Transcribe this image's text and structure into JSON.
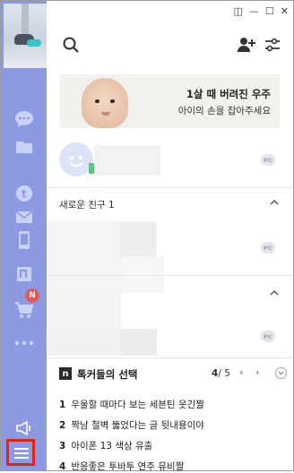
{
  "window": {
    "controls": [
      "◫",
      "—",
      "☐",
      "✕"
    ]
  },
  "sidebar": {
    "items": [
      {
        "icon": "chat-bubble-icon"
      },
      {
        "icon": "folder-icon"
      },
      {
        "icon": "t-coin-icon"
      },
      {
        "icon": "mail-icon"
      },
      {
        "icon": "mobile-icon"
      },
      {
        "icon": "n-store-icon"
      },
      {
        "icon": "shopping-cart-icon",
        "badge": "N"
      },
      {
        "icon": "more-dots-icon"
      }
    ],
    "bottom": [
      {
        "icon": "speaker-icon"
      },
      {
        "icon": "hamburger-menu-icon"
      }
    ]
  },
  "header": {
    "search_icon": "search-icon",
    "add_friend_icon": "add-friend-icon",
    "settings_icon": "settings-sliders-icon"
  },
  "banner": {
    "title": "1살 때 버려진 우주",
    "subtitle": "아이의 손을 잡아주세요"
  },
  "profile": {
    "tag": "PC"
  },
  "new_friends": {
    "title": "새로운 친구 1",
    "tag": "PC"
  },
  "section2": {
    "tag": "PC"
  },
  "picks": {
    "logo": "n",
    "title": "톡커들의 선택",
    "page_current": "4",
    "page_total": "/ 5",
    "prev": "‹",
    "next": "›",
    "items": [
      {
        "num": "1",
        "text": "우울할 때마다 보는 세븐틴 웃긴짤"
      },
      {
        "num": "2",
        "text": "짝남 철벽 뚫었다는 글 뒷내용이야"
      },
      {
        "num": "3",
        "text": "아이폰 13 색상 유출"
      },
      {
        "num": "4",
        "text": "반응좋은 투바투 연주 뮤비짤"
      }
    ]
  },
  "colors": {
    "sidebar": "#8b9ae3",
    "highlight": "#e1231a",
    "badge": "#e4585a",
    "online": "#54c97a"
  }
}
